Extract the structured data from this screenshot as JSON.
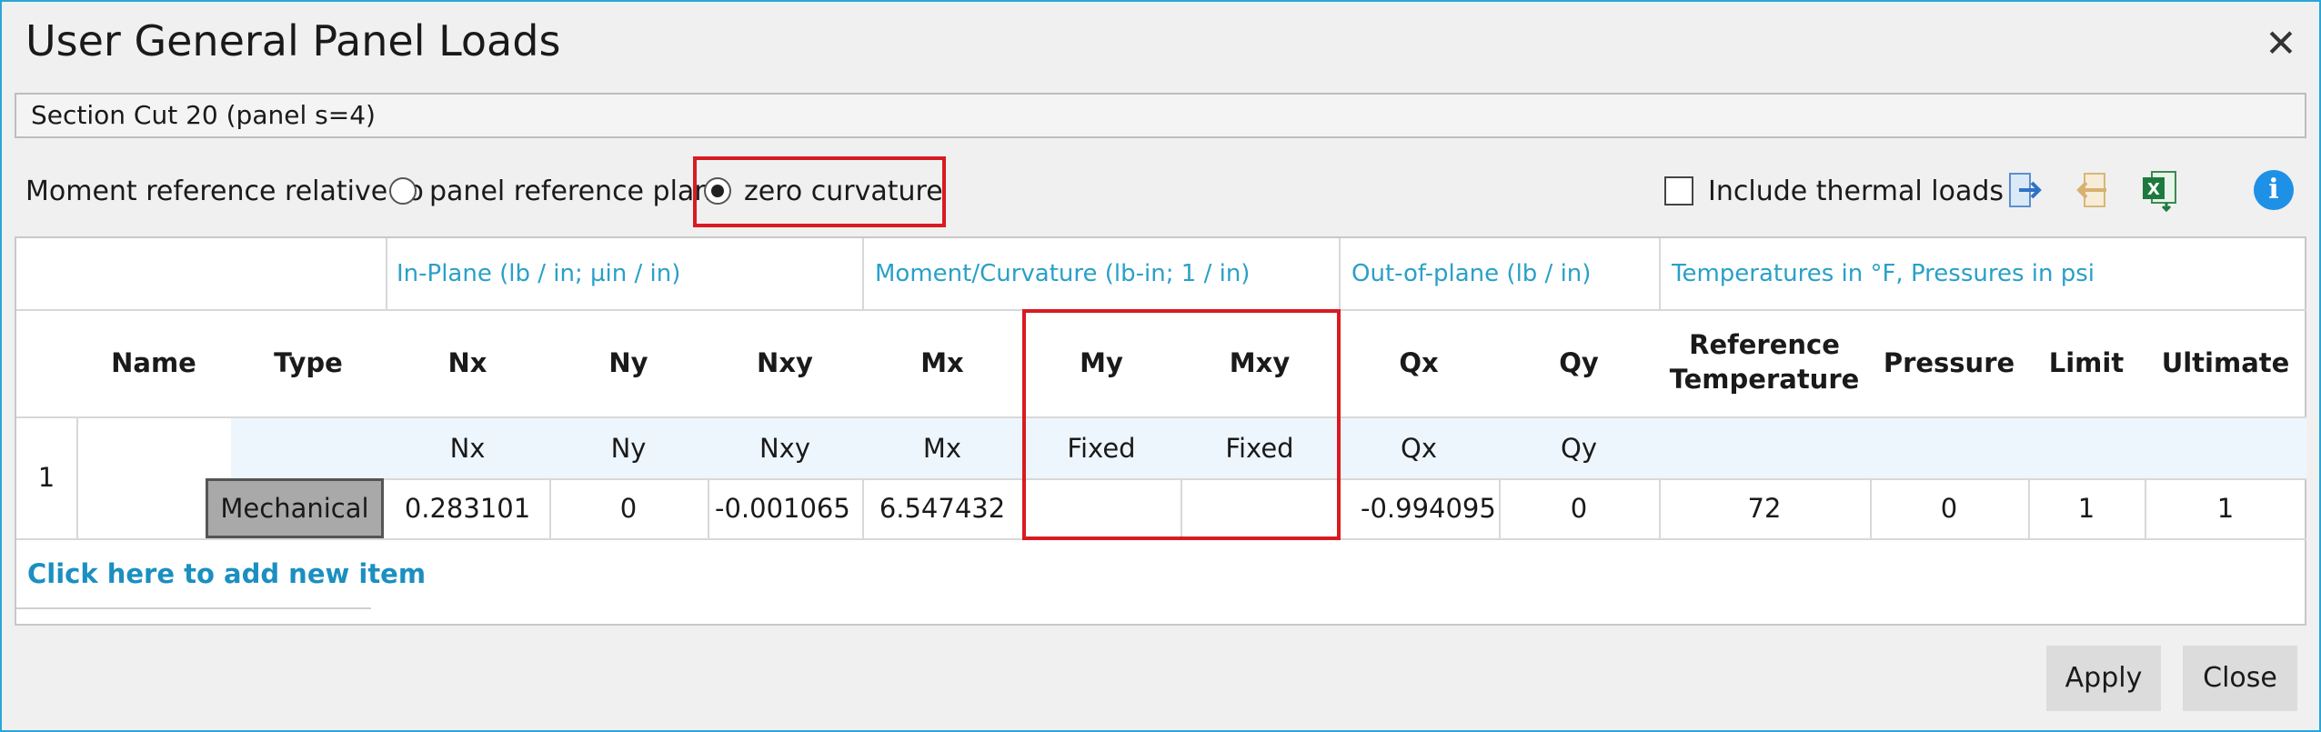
{
  "window": {
    "title": "User General Panel Loads",
    "close_glyph": "✕"
  },
  "section": {
    "label": "Section Cut 20 (panel s=4)"
  },
  "moment_ref": {
    "label": "Moment reference relative to",
    "options": [
      {
        "label": "panel reference plane",
        "selected": false
      },
      {
        "label": "zero curvature",
        "selected": true
      }
    ]
  },
  "thermal": {
    "label": "Include thermal loads",
    "checked": false
  },
  "toolbar": {
    "icons": [
      "import-icon",
      "export-icon",
      "excel-icon",
      "info-icon"
    ],
    "info_glyph": "i",
    "excel_glyph": "X"
  },
  "groups": {
    "inplane": "In-Plane (lb / in; µin / in)",
    "moment": "Moment/Curvature (lb-in; 1 / in)",
    "outofplane": "Out-of-plane (lb / in)",
    "temps": "Temperatures in °F, Pressures in psi"
  },
  "columns": {
    "name": "Name",
    "type": "Type",
    "nx": "Nx",
    "ny": "Ny",
    "nxy": "Nxy",
    "mx": "Mx",
    "my": "My",
    "mxy": "Mxy",
    "qx": "Qx",
    "qy": "Qy",
    "ref_temp_1": "Reference",
    "ref_temp_2": "Temperature",
    "pressure": "Pressure",
    "limit": "Limit",
    "ultimate": "Ultimate"
  },
  "rows": [
    {
      "index": "1",
      "name": "",
      "load_types": {
        "nx": "Nx",
        "ny": "Ny",
        "nxy": "Nxy",
        "mx": "Mx",
        "my": "Fixed",
        "mxy": "Fixed",
        "qx": "Qx",
        "qy": "Qy"
      },
      "type": "Mechanical",
      "values": {
        "nx": "0.283101",
        "ny": "0",
        "nxy": "-0.001065",
        "mx": "6.547432",
        "my": "",
        "mxy": "",
        "qx": "-0.994095",
        "qy": "0",
        "ref_temp": "72",
        "pressure": "0",
        "limit": "1",
        "ultimate": "1"
      }
    }
  ],
  "add_item": "Click here to add new item",
  "buttons": {
    "apply": "Apply",
    "close": "Close"
  },
  "colors": {
    "accent": "#2aa6d8",
    "highlight": "#d81b22",
    "group_text": "#2aa0c8",
    "link": "#1b8fc0"
  }
}
